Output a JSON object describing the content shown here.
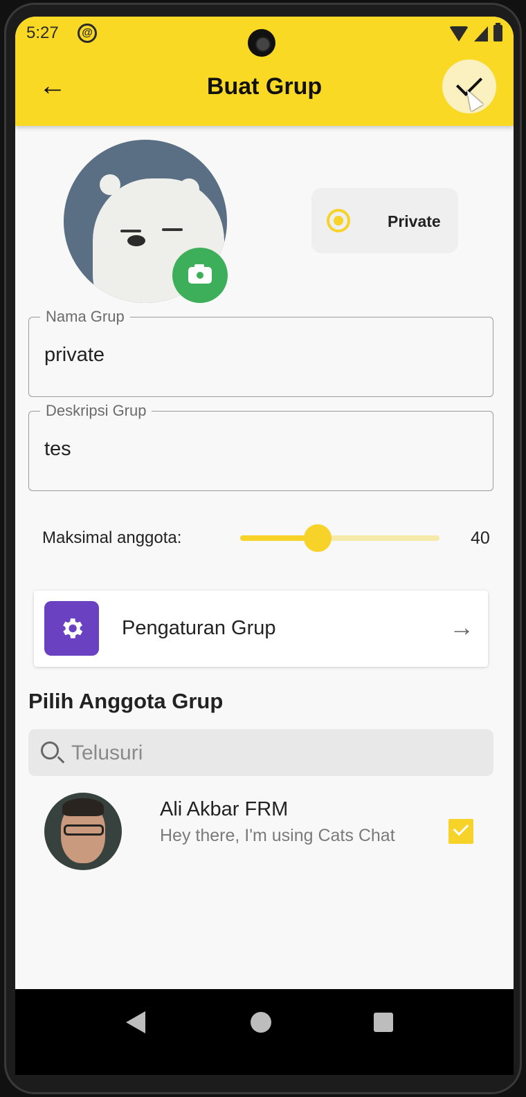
{
  "status_bar": {
    "time": "5:27"
  },
  "app_bar": {
    "title": "Buat Grup",
    "back_icon": "arrow-left-icon",
    "confirm_icon": "check-icon"
  },
  "privacy": {
    "option_label": "Private",
    "selected": true
  },
  "form": {
    "group_name": {
      "label": "Nama Grup",
      "value": "private"
    },
    "group_description": {
      "label": "Deskripsi Grup",
      "value": "tes"
    }
  },
  "max_members": {
    "label": "Maksimal anggota:",
    "value": "40",
    "slider_fraction": 0.39
  },
  "settings": {
    "label": "Pengaturan Grup",
    "icon": "gear-icon",
    "arrow_icon": "arrow-right-icon"
  },
  "members": {
    "section_title": "Pilih Anggota Grup",
    "search_placeholder": "Telusuri",
    "contacts": [
      {
        "name": "Ali Akbar FRM",
        "status": "Hey there, I'm using Cats Chat",
        "selected": true
      }
    ]
  },
  "colors": {
    "accent": "#fad925",
    "camera_button": "#3dae59",
    "settings_icon_bg": "#6a42c1"
  }
}
